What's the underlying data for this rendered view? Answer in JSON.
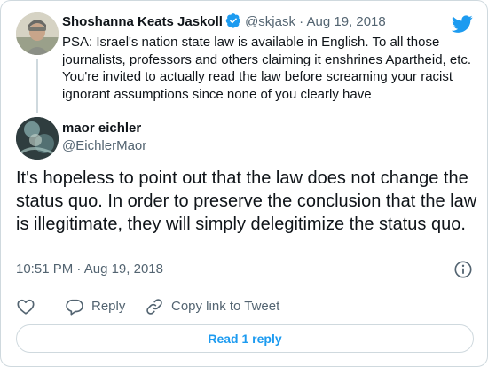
{
  "parent_tweet": {
    "author_name": "Shoshanna Keats Jaskoll",
    "handle": "@skjask",
    "separator": "·",
    "date": "Aug 19, 2018",
    "text": "PSA: Israel's nation state law is available in English. To all those journalists, professors and others claiming it enshrines Apartheid, etc. You're invited to actually read the law before screaming your racist ignorant assumptions since none of you clearly have"
  },
  "reply_tweet": {
    "author_name": "maor eichler",
    "handle": "@EichlerMaor",
    "text": "It's hopeless to point out that the law does not change the status quo. In order to preserve the conclusion that the law is illegitimate, they will simply delegitimize the status quo.",
    "time": "10:51 PM",
    "separator": "·",
    "date": "Aug 19, 2018"
  },
  "actions": {
    "reply_label": "Reply",
    "copy_link_label": "Copy link to Tweet",
    "read_replies_label": "Read 1 reply"
  },
  "colors": {
    "accent": "#1d9bf0",
    "muted": "#536471",
    "border": "#cfd9de",
    "text": "#0f1419"
  },
  "icons": {
    "brand": "twitter-bird-icon",
    "verified": "verified-badge-icon",
    "info": "info-icon",
    "like": "heart-icon",
    "reply": "comment-bubble-icon",
    "copy_link": "link-icon"
  }
}
